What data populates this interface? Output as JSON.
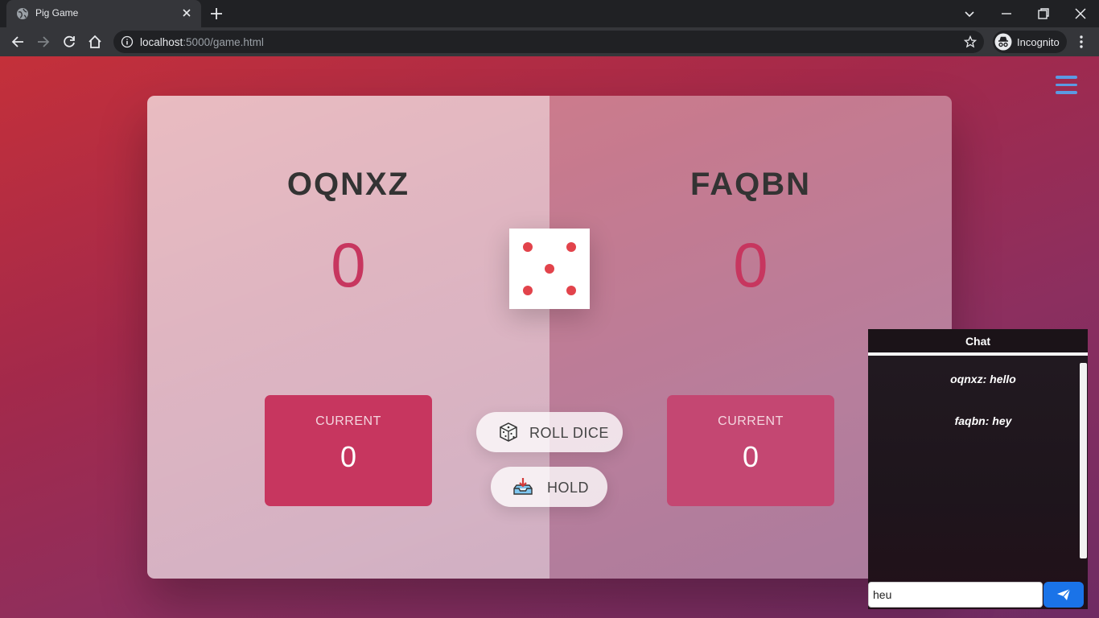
{
  "browser": {
    "tab_title": "Pig Game",
    "url_host": "localhost",
    "url_path": ":5000/game.html",
    "profile_label": "Incognito"
  },
  "game": {
    "players": [
      {
        "name": "OQNXZ",
        "score": "0",
        "current_label": "CURRENT",
        "current_score": "0",
        "active": true
      },
      {
        "name": "FAQBN",
        "score": "0",
        "current_label": "CURRENT",
        "current_score": "0",
        "active": false
      }
    ],
    "dice_value": 5,
    "roll_label": "ROLL DICE",
    "hold_label": "HOLD"
  },
  "chat": {
    "title": "Chat",
    "messages": [
      {
        "text": "oqnxz: hello"
      },
      {
        "text": "faqbn: hey"
      }
    ],
    "input_value": "heu"
  },
  "colors": {
    "accent": "#c7365f",
    "dice_pip": "#e2434b",
    "menu": "#5b9ae3",
    "send": "#1a73e8"
  }
}
